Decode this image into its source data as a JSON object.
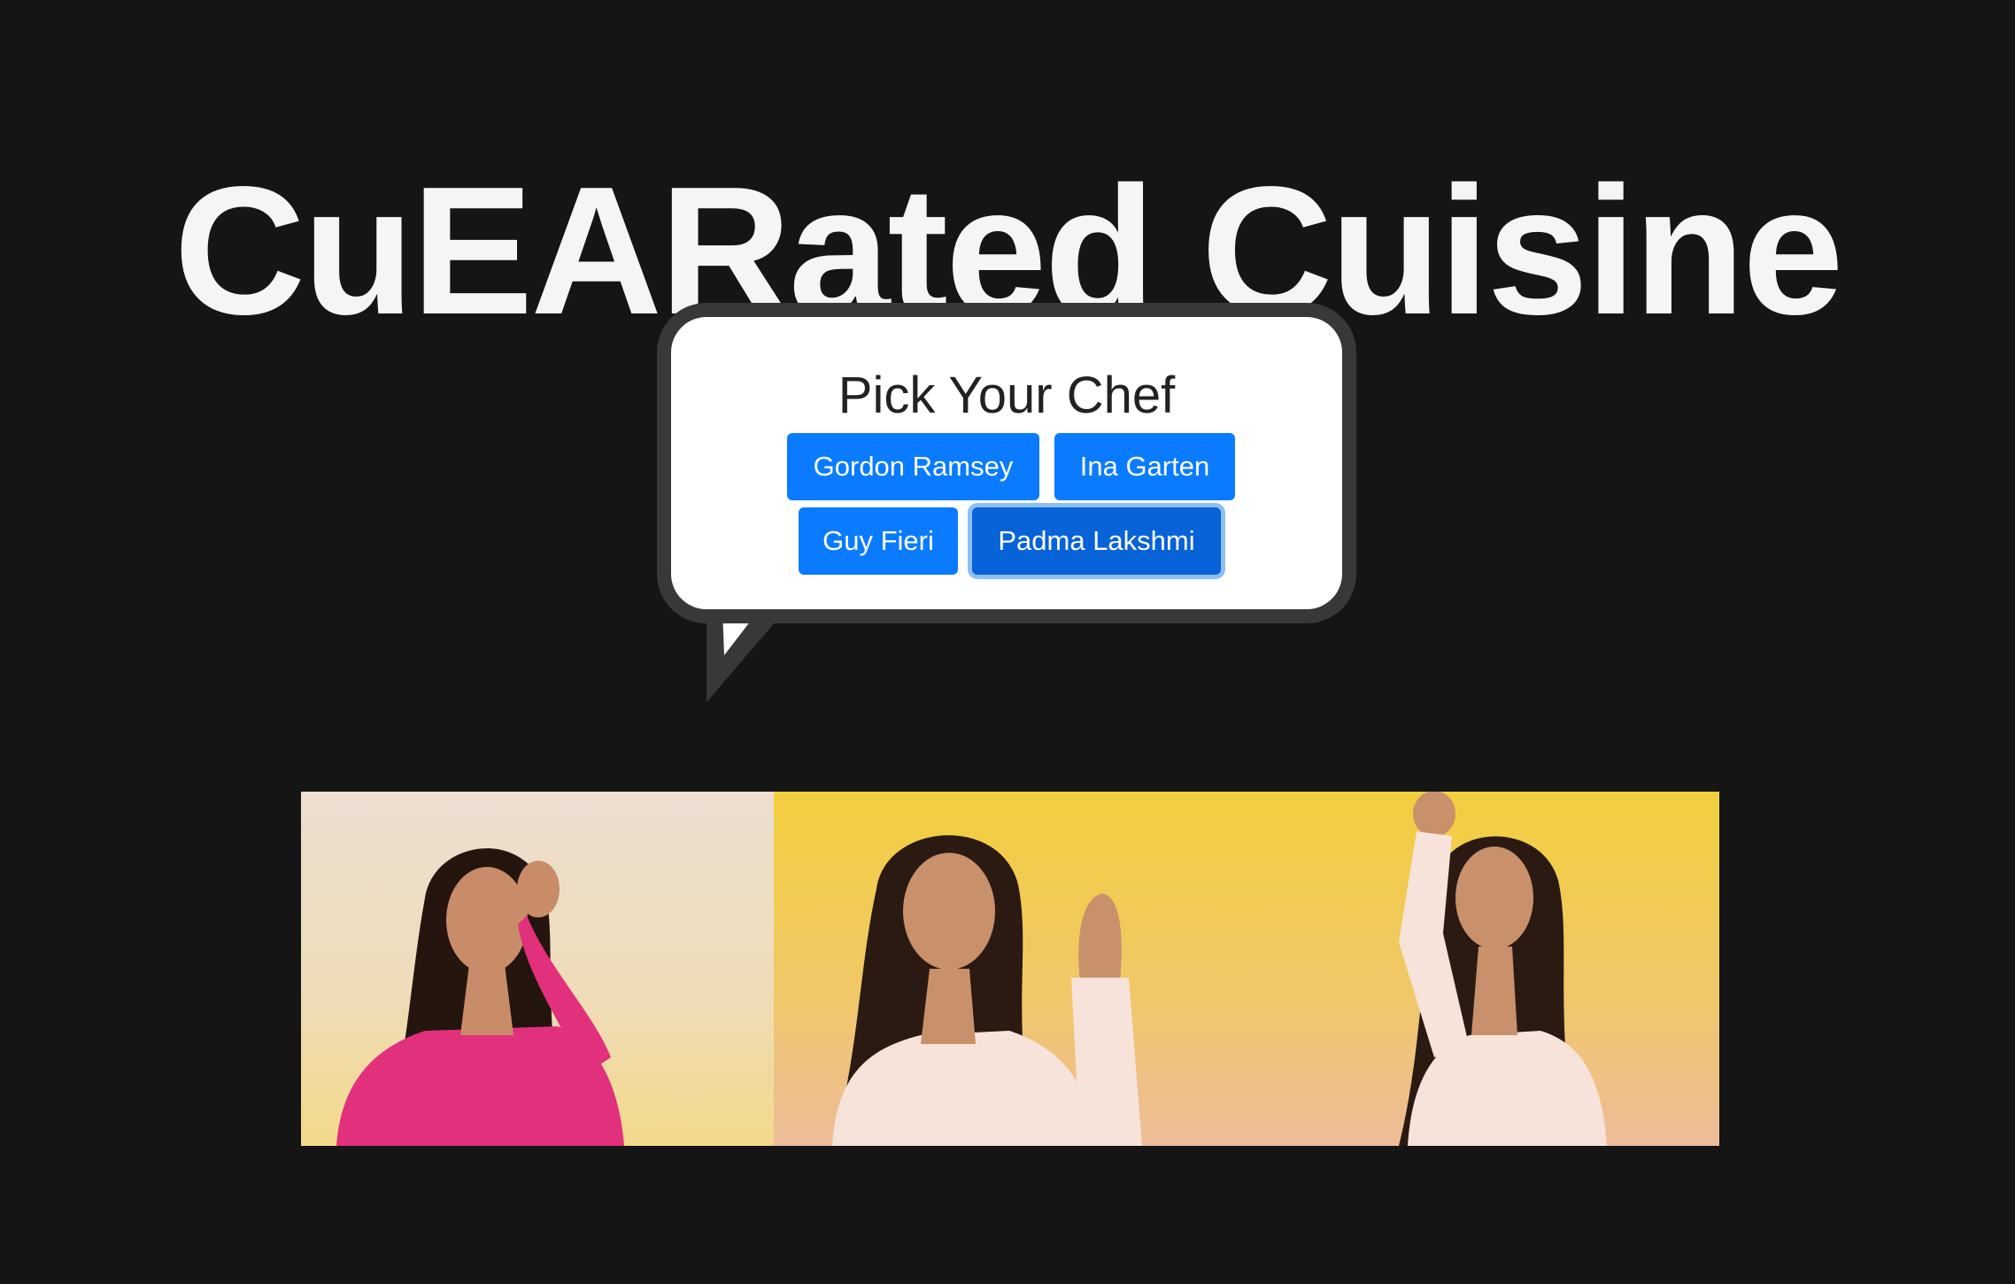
{
  "header": {
    "title": "CuEARated Cuisine"
  },
  "chef_picker": {
    "heading": "Pick Your Chef",
    "buttons": [
      {
        "label": "Gordon Ramsey",
        "selected": false
      },
      {
        "label": "Ina Garten",
        "selected": false
      },
      {
        "label": "Guy Fieri",
        "selected": false
      },
      {
        "label": "Padma Lakshmi",
        "selected": true
      }
    ]
  },
  "media": {
    "gifs": [
      {
        "subject": "Padma Lakshmi chef's kiss gesture",
        "background": "#ecdccb"
      },
      {
        "subject": "Padma Lakshmi raising hand",
        "background": "#f1cf45"
      },
      {
        "subject": "Padma Lakshmi cheering with fist raised",
        "background": "#f1cf45"
      }
    ]
  },
  "colors": {
    "page_background": "#151515",
    "title_text": "#f5f5f5",
    "bubble_border": "#383838",
    "button_primary": "#0a7bff",
    "button_active": "#0862d8",
    "button_focus_ring": "#8dbff2"
  }
}
